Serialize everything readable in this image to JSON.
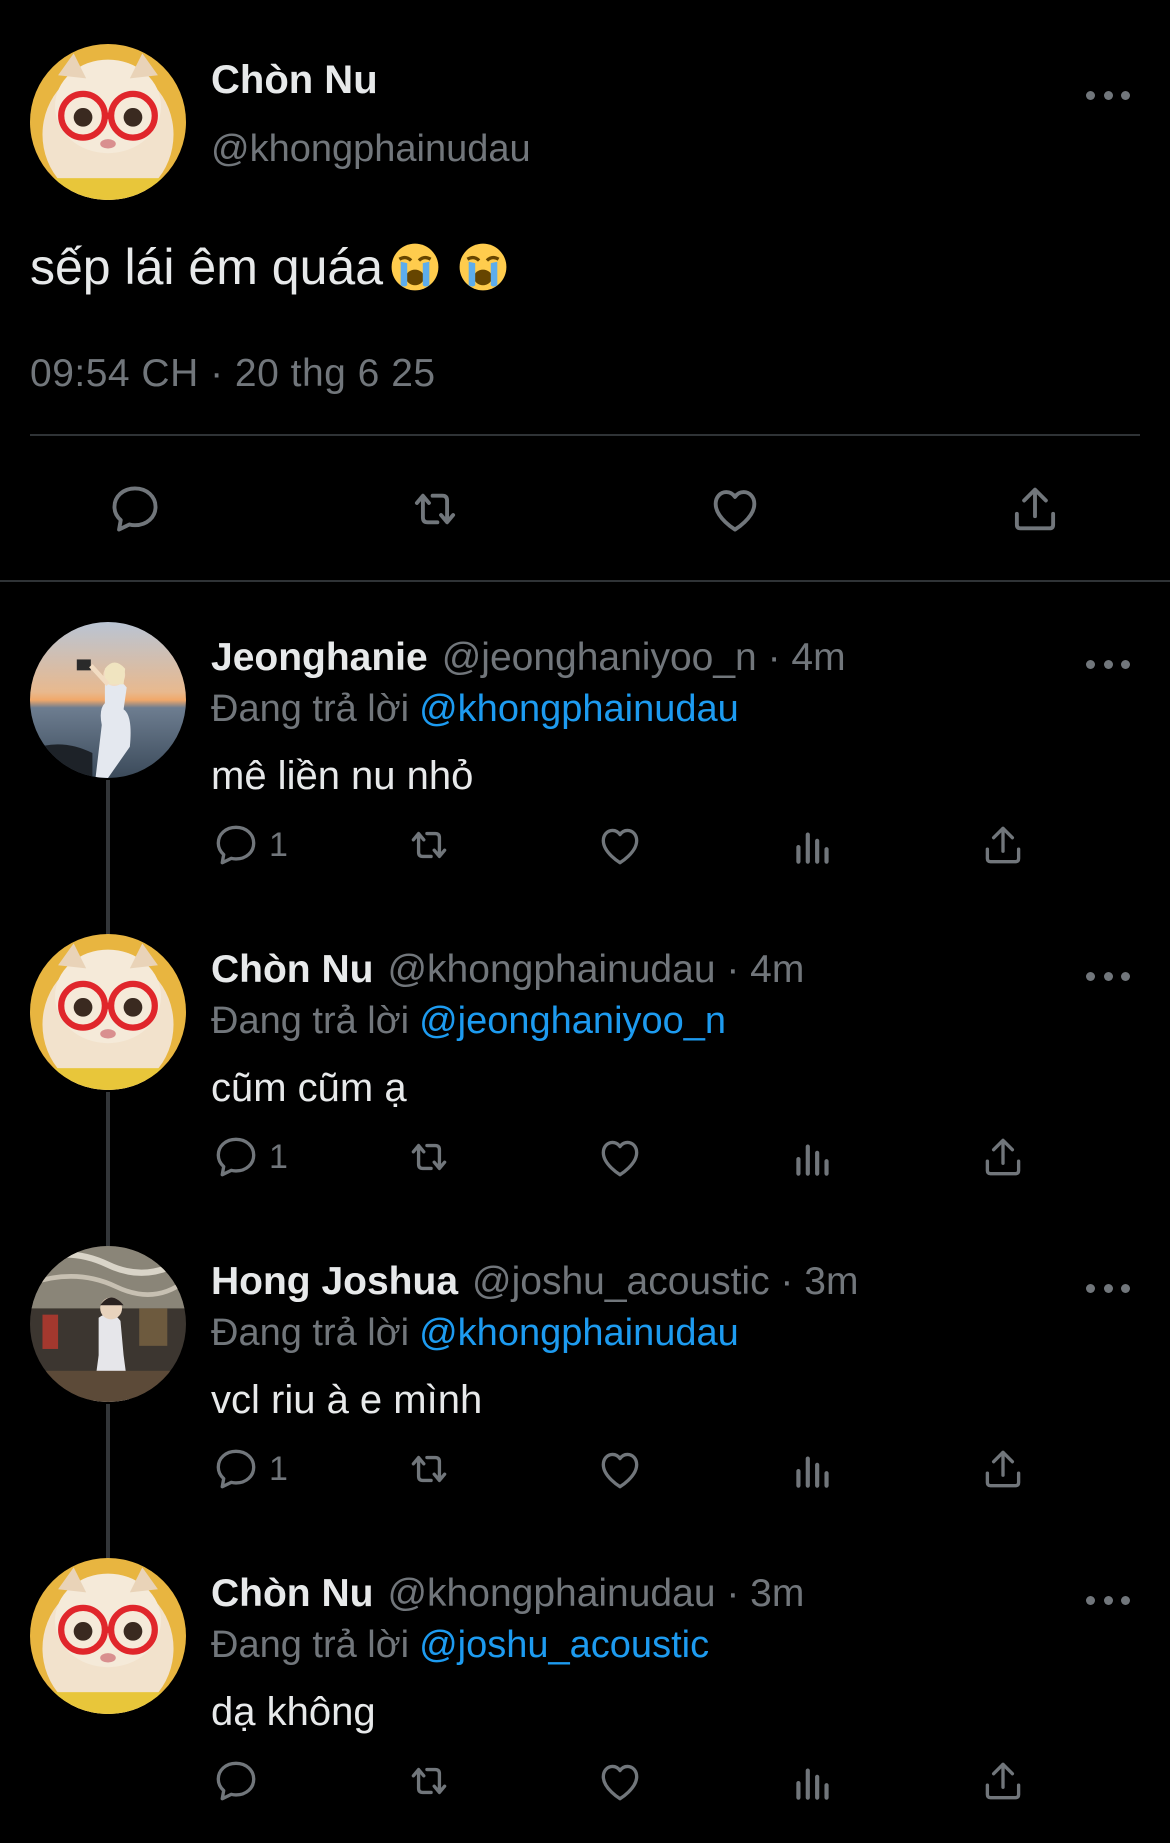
{
  "main_tweet": {
    "author_name": "Chòn Nu",
    "author_handle": "@khongphainudau",
    "text": "sếp lái êm quáa",
    "emojis": [
      "loudly-crying-face",
      "loudly-crying-face"
    ],
    "timestamp": "09:54 CH · 20 thg 6 25",
    "actions": [
      "reply-icon",
      "retweet-icon",
      "like-icon",
      "share-icon"
    ]
  },
  "replies": [
    {
      "name": "Jeonghanie",
      "meta": "@jeonghaniyoo_n · 4m",
      "replying_label": "Đang trả lời",
      "replying_to": "@khongphainudau",
      "text": "mê liền nu nhỏ",
      "reply_count": "1",
      "avatar": "photo-person-beach"
    },
    {
      "name": "Chòn Nu",
      "meta": "@khongphainudau · 4m",
      "replying_label": "Đang trả lời",
      "replying_to": "@jeonghaniyoo_n",
      "text": "cũm cũm ạ",
      "reply_count": "1",
      "avatar": "cat-with-glasses"
    },
    {
      "name": "Hong Joshua",
      "meta": "@joshu_acoustic · 3m",
      "replying_label": "Đang trả lời",
      "replying_to": "@khongphainudau",
      "text": "vcl riu à e mình",
      "reply_count": "1",
      "avatar": "photo-person-room"
    },
    {
      "name": "Chòn Nu",
      "meta": "@khongphainudau · 3m",
      "replying_label": "Đang trả lời",
      "replying_to": "@joshu_acoustic",
      "text": "dạ không",
      "reply_count": "",
      "avatar": "cat-with-glasses"
    }
  ],
  "colors": {
    "background": "#000000",
    "text_primary": "#e7e9ea",
    "text_secondary": "#71767b",
    "mention": "#1d9bf0",
    "divider": "#2f3336"
  }
}
